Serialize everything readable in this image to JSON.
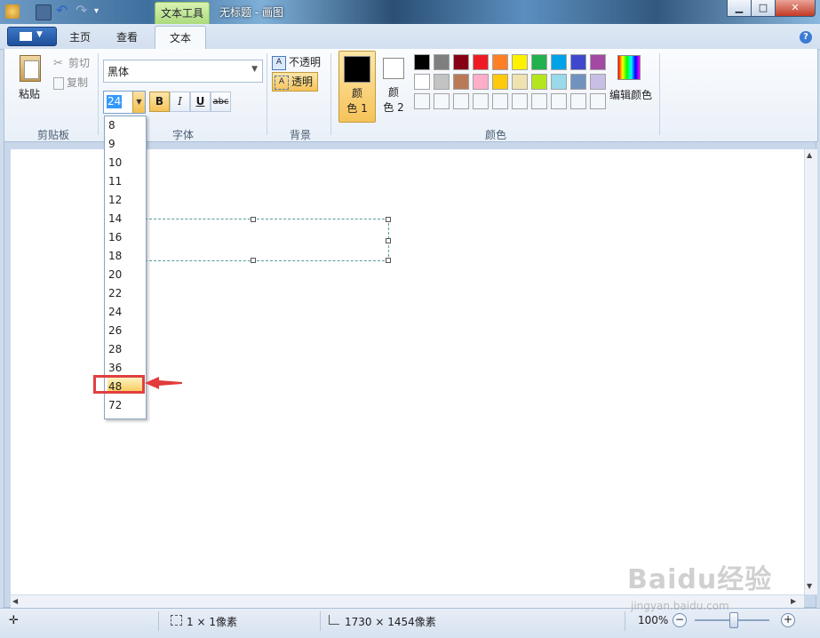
{
  "window": {
    "context_tab": "文本工具",
    "title": "无标题 - 画图",
    "minimize": "▁",
    "maximize": "□",
    "close": "✕"
  },
  "tabs": {
    "home": "主页",
    "view": "查看",
    "text": "文本",
    "help": "?"
  },
  "clipboard": {
    "paste": "粘贴",
    "cut": "剪切",
    "copy": "复制",
    "group": "剪贴板"
  },
  "font": {
    "family": "黑体",
    "size": "24",
    "bold": "B",
    "italic": "I",
    "underline": "U",
    "strikethrough": "abc",
    "group": "字体"
  },
  "background": {
    "opaque": "不透明",
    "transparent": "透明",
    "group": "背景"
  },
  "colors": {
    "color1_a": "颜",
    "color1_b": "色 1",
    "color2_a": "颜",
    "color2_b": "色 2",
    "edit": "编辑颜色",
    "group": "颜色",
    "color1": "#000000",
    "color2": "#ffffff",
    "palette_row1": [
      "#000000",
      "#7f7f7f",
      "#880015",
      "#ed1c24",
      "#ff7f27",
      "#fff200",
      "#22b14c",
      "#00a2e8",
      "#3f48cc",
      "#a349a4"
    ],
    "palette_row2": [
      "#ffffff",
      "#c3c3c3",
      "#b97a57",
      "#ffaec9",
      "#ffc90e",
      "#efe4b0",
      "#b5e61d",
      "#99d9ea",
      "#7092be",
      "#c8bfe7"
    ]
  },
  "size_options": [
    "8",
    "9",
    "10",
    "11",
    "12",
    "14",
    "16",
    "18",
    "20",
    "22",
    "24",
    "26",
    "28",
    "36",
    "48",
    "72"
  ],
  "highlighted_size": "48",
  "status": {
    "selection": "1 × 1像素",
    "image_size": "1730 × 1454像素",
    "zoom": "100%"
  },
  "watermark": {
    "logo": "Baidu经验",
    "url": "jingyan.baidu.com"
  }
}
